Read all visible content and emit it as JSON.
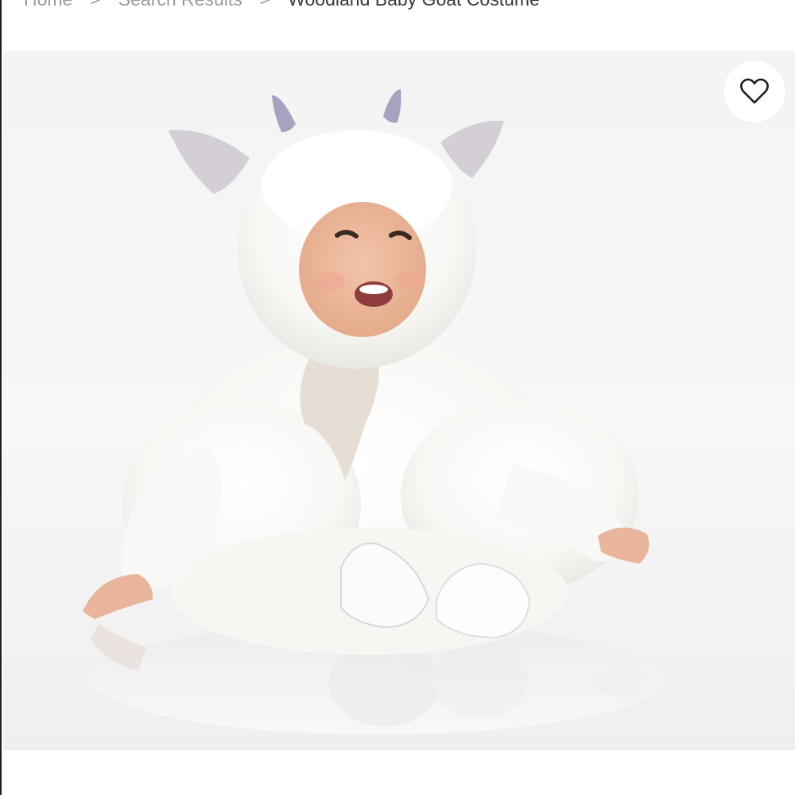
{
  "breadcrumb": {
    "items": [
      {
        "label": "Home"
      },
      {
        "label": "Search Results"
      }
    ],
    "separator": ">",
    "current": "Woodland Baby Goat Costume"
  },
  "product": {
    "image_alt_icon": "baby-goat-costume-photo",
    "wishlist_icon": "heart-outline-icon"
  },
  "colors": {
    "breadcrumb_link": "#9a9a9a",
    "breadcrumb_current": "#3a3a3a",
    "background": "#ffffff"
  }
}
